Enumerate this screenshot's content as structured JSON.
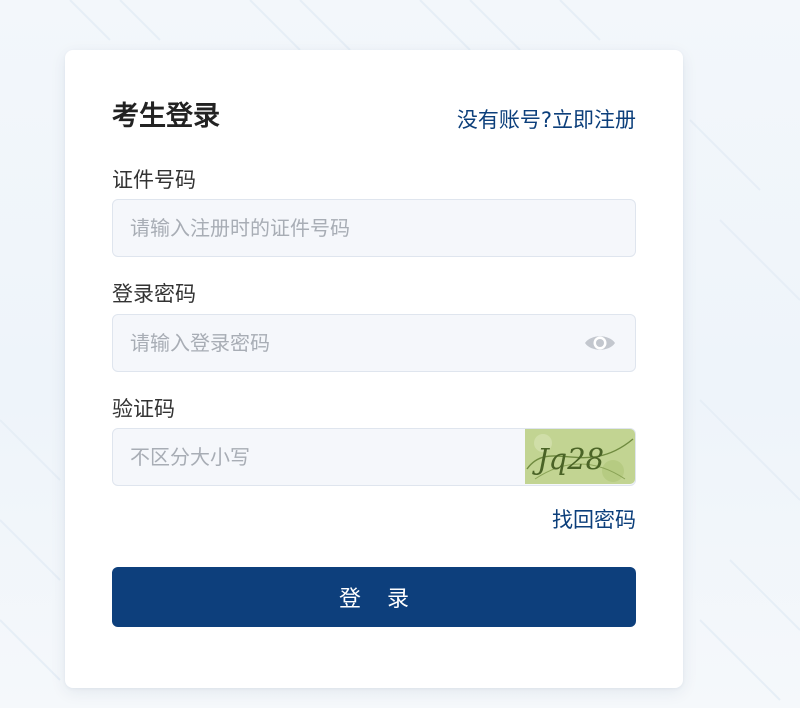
{
  "login": {
    "title": "考生登录",
    "register_link": "没有账号?立即注册",
    "id_label": "证件号码",
    "id_placeholder": "请输入注册时的证件号码",
    "password_label": "登录密码",
    "password_placeholder": "请输入登录密码",
    "captcha_label": "验证码",
    "captcha_placeholder": "不区分大小写",
    "captcha_text": "Jq28",
    "forgot_link": "找回密码",
    "submit_label": "登录"
  },
  "icons": {
    "password_toggle": "eye-icon"
  },
  "colors": {
    "brand": "#0d3f7c",
    "link": "#0c3f7b",
    "captcha_bg": "#c6d79a"
  }
}
